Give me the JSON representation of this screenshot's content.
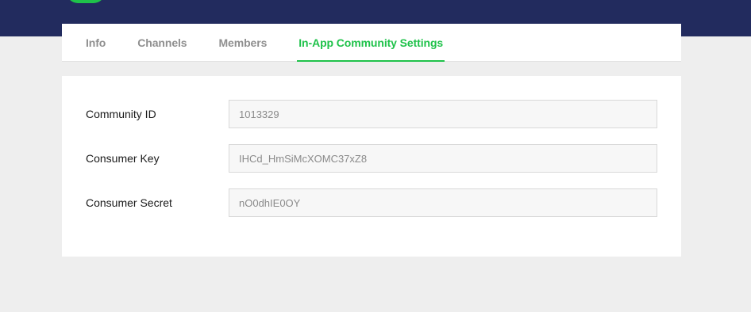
{
  "tabs": [
    {
      "label": "Info",
      "active": false
    },
    {
      "label": "Channels",
      "active": false
    },
    {
      "label": "Members",
      "active": false
    },
    {
      "label": "In-App Community Settings",
      "active": true
    }
  ],
  "settings": {
    "fields": [
      {
        "label": "Community ID",
        "value": "1013329"
      },
      {
        "label": "Consumer Key",
        "value": "IHCd_HmSiMcXOMC37xZ8"
      },
      {
        "label": "Consumer Secret",
        "value": "nO0dhIE0OY"
      }
    ]
  },
  "colors": {
    "header_bg": "#222b5e",
    "accent": "#1fc24a",
    "page_bg": "#eeeeee"
  }
}
